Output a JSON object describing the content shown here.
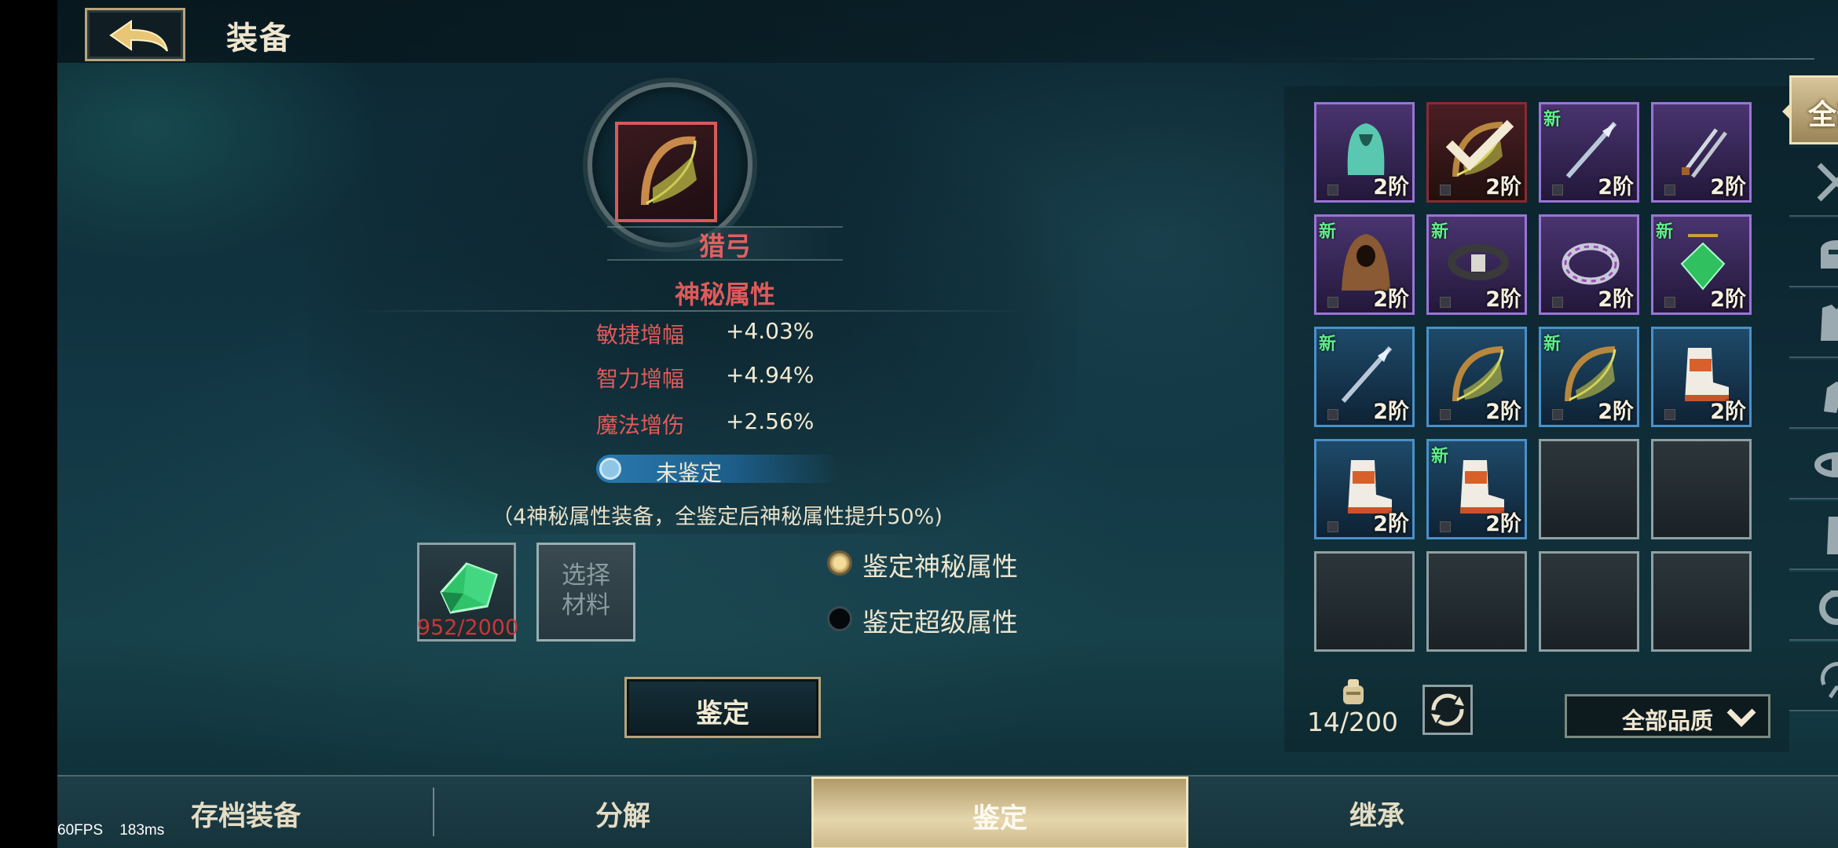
{
  "header": {
    "title": "装备"
  },
  "item": {
    "name": "猎弓",
    "mystic_title": "神秘属性",
    "stats": [
      {
        "name": "敏捷增幅",
        "value": "+4.03%"
      },
      {
        "name": "智力增幅",
        "value": "+4.94%"
      },
      {
        "name": "魔法增伤",
        "value": "+2.56%"
      }
    ],
    "status": "未鉴定",
    "note": "（4神秘属性装备，全鉴定后神秘属性提升50%)"
  },
  "materials": {
    "crystal_count": "952/2000",
    "select_label_line1": "选择",
    "select_label_line2": "材料"
  },
  "options": {
    "items": [
      {
        "label": "鉴定神秘属性",
        "selected": true
      },
      {
        "label": "鉴定超级属性",
        "selected": false
      }
    ]
  },
  "identify_button": "鉴定",
  "inventory": {
    "slots": [
      {
        "tier": "2阶",
        "quality": "purple",
        "new": false,
        "icon": "cloak-icon"
      },
      {
        "tier": "2阶",
        "quality": "red",
        "new": false,
        "icon": "bow-icon",
        "checked": true
      },
      {
        "tier": "2阶",
        "quality": "purple",
        "new": true,
        "icon": "spear-icon"
      },
      {
        "tier": "2阶",
        "quality": "purple",
        "new": false,
        "icon": "daggers-icon"
      },
      {
        "tier": "2阶",
        "quality": "purple",
        "new": true,
        "icon": "hood-icon"
      },
      {
        "tier": "2阶",
        "quality": "purple",
        "new": true,
        "icon": "belt-icon"
      },
      {
        "tier": "2阶",
        "quality": "purple",
        "new": false,
        "icon": "ring-icon"
      },
      {
        "tier": "2阶",
        "quality": "purple",
        "new": true,
        "icon": "amulet-icon"
      },
      {
        "tier": "2阶",
        "quality": "blue",
        "new": true,
        "icon": "spear-icon"
      },
      {
        "tier": "2阶",
        "quality": "blue",
        "new": false,
        "icon": "bow-icon"
      },
      {
        "tier": "2阶",
        "quality": "blue",
        "new": true,
        "icon": "bow-icon"
      },
      {
        "tier": "2阶",
        "quality": "blue",
        "new": false,
        "icon": "boots-icon"
      },
      {
        "tier": "2阶",
        "quality": "blue",
        "new": false,
        "icon": "boots-icon"
      },
      {
        "tier": "2阶",
        "quality": "blue",
        "new": true,
        "icon": "boots-icon"
      }
    ],
    "new_label": "新",
    "capacity": "14/200",
    "quality_filter": "全部品质"
  },
  "categories": {
    "all_label": "全部",
    "icons": [
      "swords-icon",
      "helmet-icon",
      "armor-icon",
      "gloves-icon",
      "belt-icon",
      "boots-icon",
      "ring-icon",
      "accessory-icon"
    ]
  },
  "bottom_tabs": {
    "archive": "存档装备",
    "decompose": "分解",
    "identify": "鉴定",
    "inherit": "继承"
  },
  "debug": {
    "fps": "60FPS",
    "latency": "183ms"
  },
  "colors": {
    "accent_gold": "#b9a57c",
    "stat_red": "#e05a5a",
    "purple_quality": "#9a74d6",
    "blue_quality": "#4a90c8",
    "new_green": "#5ef08a"
  }
}
